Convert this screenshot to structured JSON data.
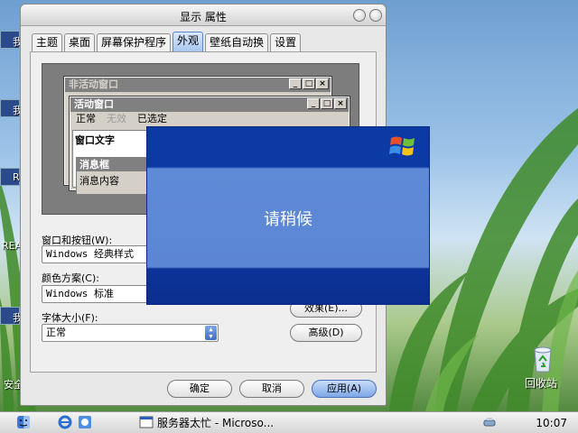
{
  "desktop": {
    "left_labels": [
      "我",
      "我",
      "R",
      "REA",
      "我",
      "安全"
    ],
    "recycle_bin": "回收站"
  },
  "dialog": {
    "title": "显示 属性",
    "tabs": [
      "主题",
      "桌面",
      "屏幕保护程序",
      "外观",
      "壁纸自动换",
      "设置"
    ],
    "active_tab": "外观",
    "preview": {
      "inactive_window": "非活动窗口",
      "active_window": "活动窗口",
      "menu_normal": "正常",
      "menu_disabled": "无效",
      "menu_selected": "已选定",
      "window_text": "窗口文字",
      "message_box_title": "消息框",
      "message_box_text": "消息内容"
    },
    "windows_buttons_label": "窗口和按钮(W):",
    "windows_buttons_value": "Windows 经典样式",
    "color_scheme_label": "颜色方案(C):",
    "color_scheme_value": "Windows 标准",
    "font_size_label": "字体大小(F):",
    "font_size_value": "正常",
    "effects_button": "效果(E)...",
    "advanced_button": "高级(D)",
    "ok_button": "确定",
    "cancel_button": "取消",
    "apply_button": "应用(A)"
  },
  "wait_dialog": {
    "message": "请稍候"
  },
  "taskbar": {
    "task_label": "服务器太忙 - Microso...",
    "clock": "10:07"
  },
  "colors": {
    "wait_blue": "#0b3aa5",
    "wait_band": "#5b86d4"
  }
}
